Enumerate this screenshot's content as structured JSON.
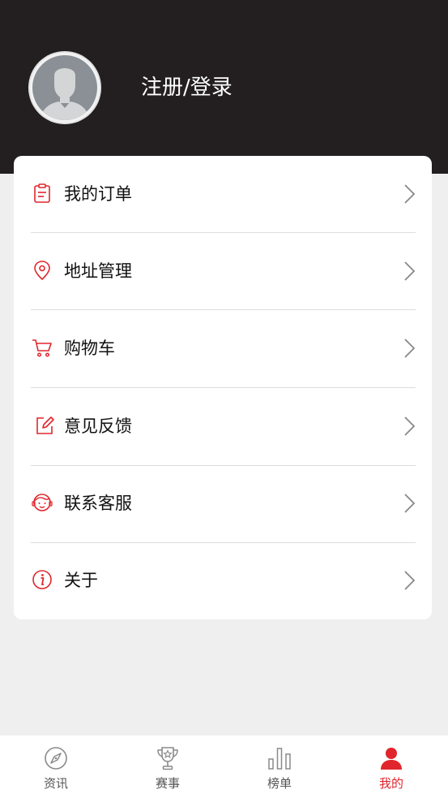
{
  "header": {
    "login_text": "注册/登录"
  },
  "menu": [
    {
      "label": "我的订单",
      "icon": "clipboard-icon"
    },
    {
      "label": "地址管理",
      "icon": "location-pin-icon"
    },
    {
      "label": "购物车",
      "icon": "cart-icon"
    },
    {
      "label": " 意见反馈",
      "icon": "edit-icon"
    },
    {
      "label": "联系客服",
      "icon": "customer-service-icon"
    },
    {
      "label": "关于",
      "icon": "info-icon"
    }
  ],
  "tabbar": {
    "tabs": [
      {
        "label": "资讯",
        "icon": "compass-icon"
      },
      {
        "label": "赛事",
        "icon": "trophy-icon"
      },
      {
        "label": "榜单",
        "icon": "bar-chart-icon"
      },
      {
        "label": "我的",
        "icon": "user-icon"
      }
    ],
    "active_index": 3
  },
  "colors": {
    "accent": "#e0262c",
    "header_bg": "#231f20",
    "page_bg": "#efefef"
  }
}
